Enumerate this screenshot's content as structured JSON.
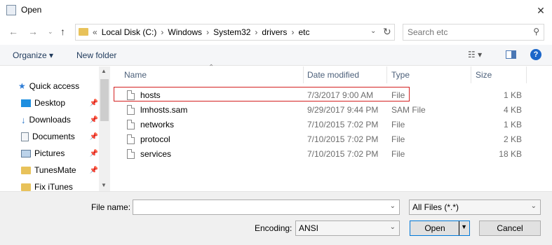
{
  "window": {
    "title": "Open"
  },
  "address": {
    "crumbs": [
      "«",
      "Local Disk (C:)",
      "Windows",
      "System32",
      "drivers",
      "etc"
    ],
    "separator": "›"
  },
  "search": {
    "placeholder": "Search etc"
  },
  "toolbar": {
    "organize": "Organize ▾",
    "new_folder": "New folder"
  },
  "nav": {
    "items": [
      {
        "label": "Quick access",
        "icon": "star-icon"
      },
      {
        "label": "Desktop",
        "icon": "desktop-icon",
        "pinned": true
      },
      {
        "label": "Downloads",
        "icon": "download-icon",
        "pinned": true
      },
      {
        "label": "Documents",
        "icon": "documents-icon",
        "pinned": true
      },
      {
        "label": "Pictures",
        "icon": "pictures-icon",
        "pinned": true
      },
      {
        "label": "TunesMate",
        "icon": "folder-icon",
        "pinned": true
      },
      {
        "label": "Fix iTunes",
        "icon": "folder-icon"
      }
    ]
  },
  "columns": {
    "name": "Name",
    "date": "Date modified",
    "type": "Type",
    "size": "Size"
  },
  "files": [
    {
      "name": "hosts",
      "date": "7/3/2017 9:00 AM",
      "type": "File",
      "size": "1 KB"
    },
    {
      "name": "lmhosts.sam",
      "date": "9/29/2017 9:44 PM",
      "type": "SAM File",
      "size": "4 KB"
    },
    {
      "name": "networks",
      "date": "7/10/2015 7:02 PM",
      "type": "File",
      "size": "1 KB"
    },
    {
      "name": "protocol",
      "date": "7/10/2015 7:02 PM",
      "type": "File",
      "size": "2 KB"
    },
    {
      "name": "services",
      "date": "7/10/2015 7:02 PM",
      "type": "File",
      "size": "18 KB"
    }
  ],
  "bottom": {
    "filename_label": "File name:",
    "filename_value": "",
    "filetype_value": "All Files  (*.*)",
    "encoding_label": "Encoding:",
    "encoding_value": "ANSI",
    "open_label": "Open",
    "cancel_label": "Cancel"
  },
  "colors": {
    "accent": "#0078d7",
    "highlight": "#d32020",
    "header_text": "#4c607a"
  }
}
